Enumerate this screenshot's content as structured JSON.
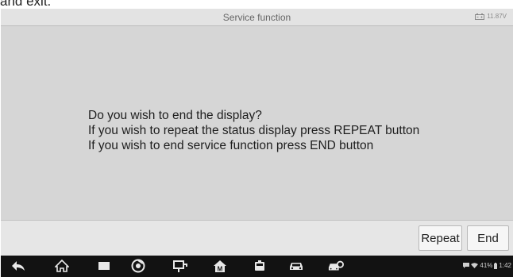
{
  "page_caption": "and exit.",
  "header": {
    "title": "Service function",
    "battery_voltage": "11.87V"
  },
  "message": {
    "lines": [
      "Do you wish to end the display?",
      "If you wish to repeat the status display press REPEAT button",
      "If you wish to end service function press END button"
    ]
  },
  "actions": {
    "repeat_label": "Repeat",
    "end_label": "End"
  },
  "navbar": {
    "icons": [
      "back-icon",
      "home-icon",
      "recent-apps-icon",
      "chrome-icon",
      "vci-icon",
      "maxi-home-icon",
      "gallery-icon",
      "car-icon",
      "car-settings-icon"
    ],
    "battery_percent": "41%",
    "time": "1:42"
  },
  "colors": {
    "screen_bg": "#d6d6d6",
    "titlebar_bg": "#e3e3e3",
    "navbar_bg": "#121212"
  }
}
